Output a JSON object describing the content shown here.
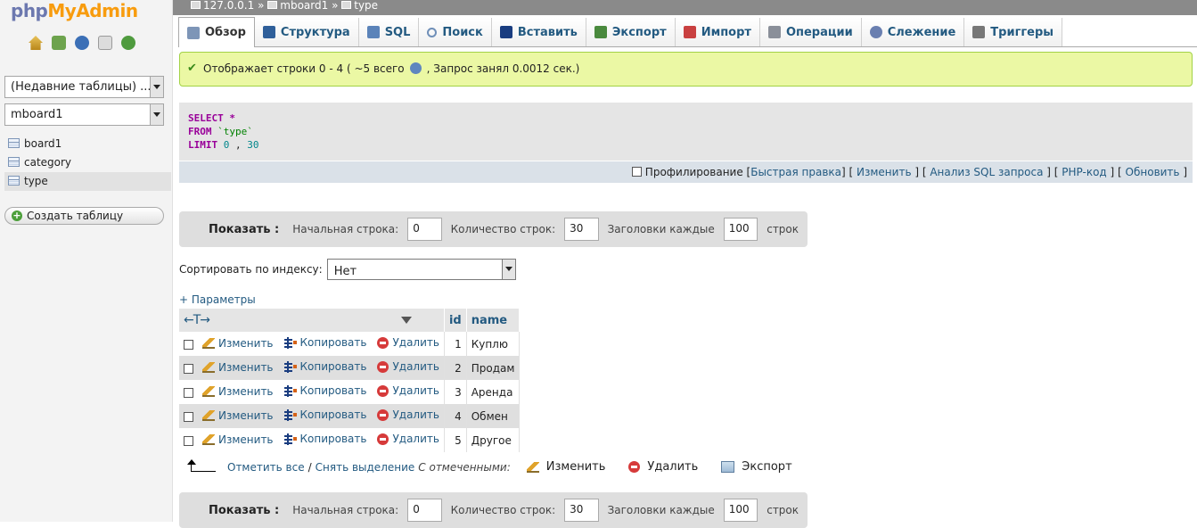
{
  "logo": {
    "part1": "php",
    "part2": "My",
    "part3": "Admin"
  },
  "nav": {
    "recent_tables": "(Недавние таблицы) ...",
    "database": "mboard1",
    "tables": [
      {
        "name": "board1"
      },
      {
        "name": "category"
      },
      {
        "name": "type",
        "selected": true
      }
    ],
    "create_table": "Создать таблицу"
  },
  "breadcrumb": {
    "server": "127.0.0.1",
    "database": "mboard1",
    "table": "type",
    "sep": "»"
  },
  "tabs": [
    {
      "label": "Обзор",
      "icon": "browse-icon",
      "active": true
    },
    {
      "label": "Структура",
      "icon": "structure-icon"
    },
    {
      "label": "SQL",
      "icon": "sql-icon"
    },
    {
      "label": "Поиск",
      "icon": "search-icon"
    },
    {
      "label": "Вставить",
      "icon": "insert-icon"
    },
    {
      "label": "Экспорт",
      "icon": "export-icon"
    },
    {
      "label": "Импорт",
      "icon": "import-icon"
    },
    {
      "label": "Операции",
      "icon": "operations-icon"
    },
    {
      "label": "Слежение",
      "icon": "tracking-icon"
    },
    {
      "label": "Триггеры",
      "icon": "triggers-icon"
    }
  ],
  "success": {
    "part1": "Отображает строки 0 - 4 ( ~5 всего",
    "part2": ", Запрос занял 0.0012 сек.)"
  },
  "sql": {
    "select": "SELECT",
    "star": "*",
    "from": "FROM",
    "table": "`type`",
    "limit": "LIMIT",
    "offset": "0",
    "comma": ",",
    "count": "30"
  },
  "sql_tools": {
    "profiling": "Профилирование",
    "links": [
      "Быстрая правка",
      "Изменить",
      "Анализ SQL запроса",
      "PHP-код",
      "Обновить"
    ]
  },
  "navbar": {
    "show": "Показать :",
    "start_label": "Начальная строка:",
    "start_value": "0",
    "count_label": "Количество строк:",
    "count_value": "30",
    "headers_label": "Заголовки каждые",
    "headers_value": "100",
    "rows_suffix": "строк"
  },
  "sort": {
    "label": "Сортировать по индексу:",
    "value": "Нет"
  },
  "params_link": "+ Параметры",
  "table": {
    "col_arrows": "←T→",
    "columns": [
      "id",
      "name"
    ],
    "actions": {
      "edit": "Изменить",
      "copy": "Копировать",
      "delete": "Удалить"
    },
    "rows": [
      {
        "id": "1",
        "name": "Куплю"
      },
      {
        "id": "2",
        "name": "Продам"
      },
      {
        "id": "3",
        "name": "Аренда"
      },
      {
        "id": "4",
        "name": "Обмен"
      },
      {
        "id": "5",
        "name": "Другое"
      }
    ]
  },
  "bulk": {
    "check_all": "Отметить все",
    "separator": "/",
    "uncheck": "Снять выделение",
    "with_selected": "С отмеченными:",
    "edit": "Изменить",
    "delete": "Удалить",
    "export": "Экспорт"
  },
  "colors": {
    "link": "#235a81",
    "success_bg": "#ebf8a4",
    "success_border": "#a2d246",
    "sql_keyword": "#990099"
  }
}
